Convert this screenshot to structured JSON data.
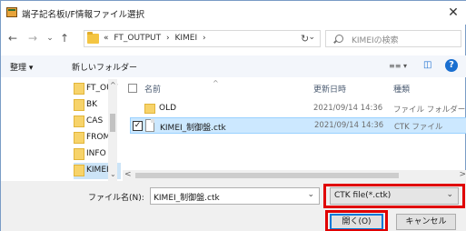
{
  "window": {
    "title": "端子記名板I/F情報ファイル選択",
    "close_glyph": "✕"
  },
  "nav": {
    "back_glyph": "←",
    "forward_glyph": "→",
    "recent_glyph": "⌄",
    "up_glyph": "↑",
    "refresh_glyph": "↻",
    "breadcrumbs": [
      "«",
      "FT_OUTPUT",
      "›",
      "KIMEI",
      "›"
    ],
    "addr_dropdown_glyph": "⌄",
    "search_placeholder": "KIMEIの検索"
  },
  "toolbar": {
    "organize_label": "整理 ▾",
    "new_folder_label": "新しいフォルダー",
    "view_glyph": "≡≡ ▾",
    "pane_glyph": "◫",
    "help_glyph": "?"
  },
  "tree": {
    "items": [
      {
        "label": "FT_OUT",
        "selected": false
      },
      {
        "label": "BK",
        "selected": false
      },
      {
        "label": "CAS",
        "selected": false
      },
      {
        "label": "FROM",
        "selected": false
      },
      {
        "label": "INFO",
        "selected": false
      },
      {
        "label": "KIMEI",
        "selected": true
      }
    ],
    "scroll_up_glyph": "^",
    "scroll_down_glyph": "⌄"
  },
  "list": {
    "columns": {
      "name": "名前",
      "modified": "更新日時",
      "type": "種類"
    },
    "sort_glyph": "^",
    "rows": [
      {
        "name": "OLD",
        "modified": "2021/09/14 14:36",
        "type": "ファイル フォルダー",
        "kind": "folder",
        "selected": false
      },
      {
        "name": "KIMEI_制御盤.ctk",
        "modified": "2021/09/14 14:36",
        "type": "CTK ファイル",
        "kind": "file",
        "selected": true,
        "check_glyph": "✓"
      }
    ],
    "hscroll_left_glyph": "<",
    "hscroll_right_glyph": ">"
  },
  "footer": {
    "filename_label": "ファイル名(N):",
    "filename_value": "KIMEI_制御盤.ctk",
    "filename_dropdown_glyph": "⌄",
    "filter_value": "CTK file(*.ctk)",
    "filter_dropdown_glyph": "⌄",
    "open_label": "開く(O)",
    "cancel_label": "キャンセル"
  },
  "colors": {
    "highlight": "#e00000",
    "selection": "#cce8ff",
    "accent": "#0078d7"
  }
}
